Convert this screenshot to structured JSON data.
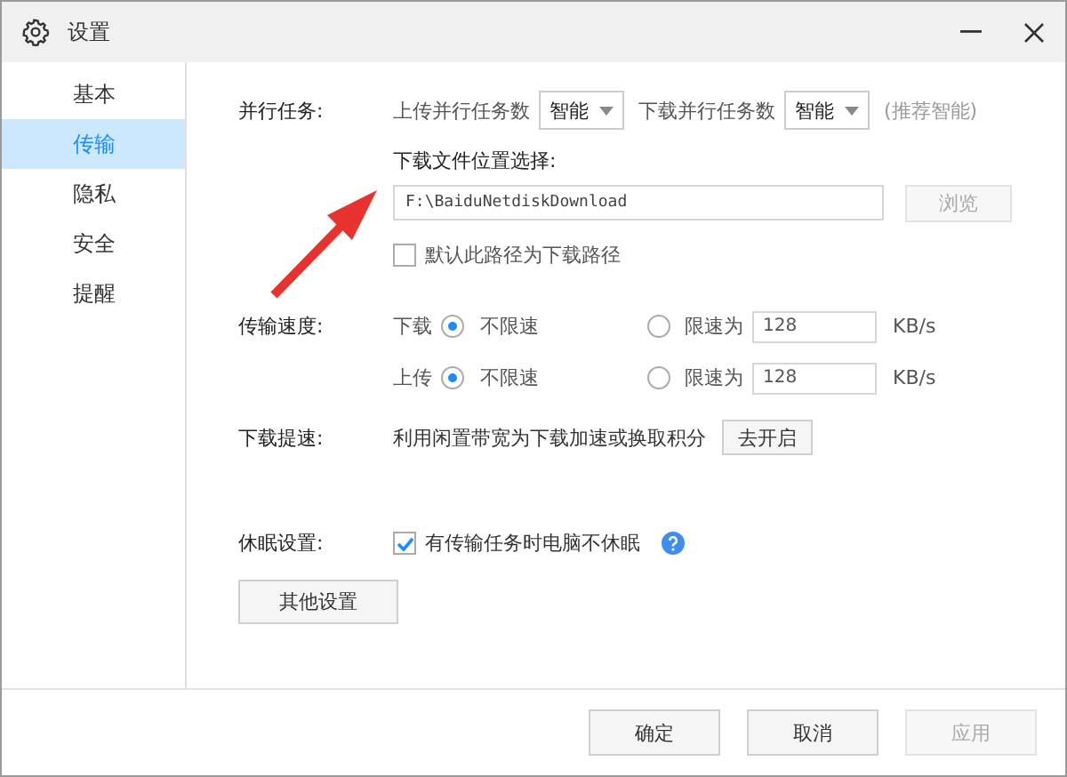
{
  "window": {
    "title": "设置"
  },
  "sidebar": {
    "items": [
      {
        "label": "基本",
        "selected": false
      },
      {
        "label": "传输",
        "selected": true
      },
      {
        "label": "隐私",
        "selected": false
      },
      {
        "label": "安全",
        "selected": false
      },
      {
        "label": "提醒",
        "selected": false
      }
    ]
  },
  "parallel": {
    "label": "并行任务:",
    "upload_label": "上传并行任务数",
    "upload_value": "智能",
    "download_label": "下载并行任务数",
    "download_value": "智能",
    "hint": "(推荐智能)"
  },
  "download_location": {
    "label": "下载文件位置选择:",
    "value": "F:\\BaiduNetdiskDownload",
    "browse": "浏览",
    "browse_disabled": true,
    "default_checkbox": {
      "label": "默认此路径为下载路径",
      "checked": false
    }
  },
  "speed": {
    "label": "传输速度:",
    "rows": [
      {
        "label": "下载",
        "unlimited": "不限速",
        "limit": "限速为",
        "value": "128",
        "unit": "KB/s",
        "unlimited_selected": true
      },
      {
        "label": "上传",
        "unlimited": "不限速",
        "limit": "限速为",
        "value": "128",
        "unit": "KB/s",
        "unlimited_selected": true
      }
    ]
  },
  "boost": {
    "label": "下载提速:",
    "text": "利用闲置带宽为下载加速或换取积分",
    "button": "去开启"
  },
  "sleep": {
    "label": "休眠设置:",
    "checkbox": {
      "label": "有传输任务时电脑不休眠",
      "checked": true
    }
  },
  "other_button": "其他设置",
  "buttons": [
    {
      "label": "确定",
      "disabled": false
    },
    {
      "label": "取消",
      "disabled": false
    },
    {
      "label": "应用",
      "disabled": true
    }
  ]
}
